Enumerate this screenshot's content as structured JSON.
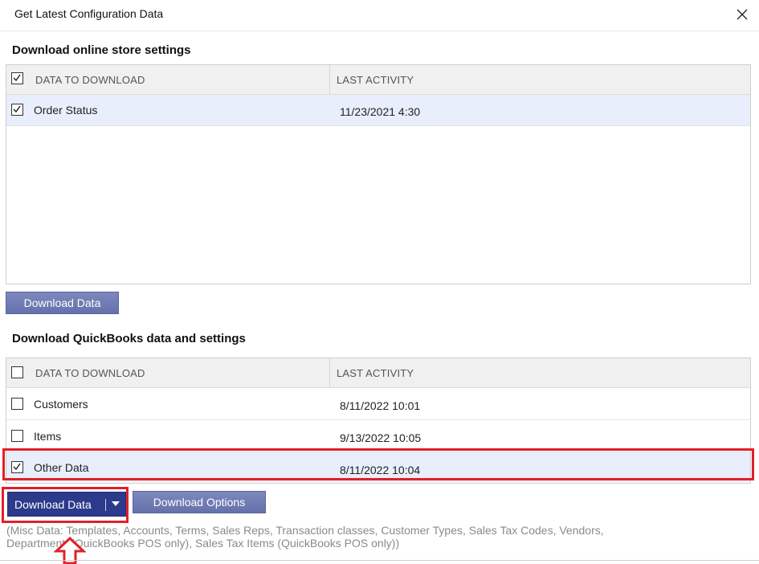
{
  "window": {
    "title": "Get Latest Configuration Data"
  },
  "store_section": {
    "title": "Download online store settings",
    "header": {
      "col1": "DATA TO DOWNLOAD",
      "col2": "LAST ACTIVITY",
      "all_checked": true
    },
    "rows": [
      {
        "label": "Order Status",
        "last_activity": "11/23/2021 4:30",
        "checked": true,
        "selected": true
      }
    ],
    "button_label": "Download Data"
  },
  "qb_section": {
    "title": "Download QuickBooks data and settings",
    "header": {
      "col1": "DATA TO DOWNLOAD",
      "col2": "LAST ACTIVITY",
      "all_checked": false
    },
    "rows": [
      {
        "label": "Customers",
        "last_activity": "8/11/2022 10:01",
        "checked": false,
        "selected": false
      },
      {
        "label": "Items",
        "last_activity": "9/13/2022 10:05",
        "checked": false,
        "selected": false
      },
      {
        "label": "Other Data",
        "last_activity": "8/11/2022 10:04",
        "checked": true,
        "selected": true
      }
    ],
    "download_button_label": "Download Data",
    "options_button_label": "Download Options"
  },
  "note": "(Misc Data: Templates, Accounts, Terms, Sales Reps, Transaction classes, Customer Types, Sales Tax Codes, Vendors, Departments(QuickBooks POS only), Sales Tax Items (QuickBooks POS only))",
  "colors": {
    "accent_dark": "#2c3a8c",
    "accent_light": "#7d88bd",
    "annotation_red": "#e0202a",
    "row_selected": "#e8eefb"
  },
  "icons": {
    "close": "close-icon",
    "checkbox": "checkmark-icon",
    "dropdown": "caret-down-icon",
    "annotation": "up-arrow-icon"
  }
}
